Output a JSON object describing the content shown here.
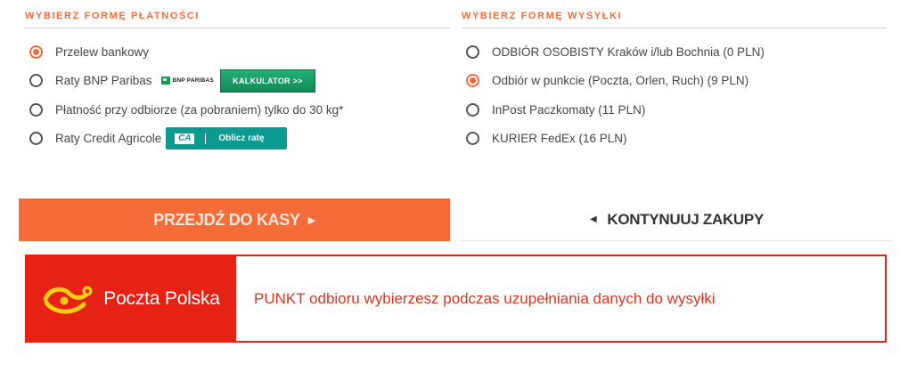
{
  "payment": {
    "title": "WYBIERZ FORMĘ PŁATNOŚCI",
    "options": [
      {
        "label": "Przelew bankowy",
        "checked": true
      },
      {
        "label": "Raty BNP Paribas",
        "checked": false,
        "logo_text": "BNP PARIBAS",
        "button": "KALKULATOR >>"
      },
      {
        "label": "Płatność przy odbiorze (za pobraniem) tylko do 30 kg*",
        "checked": false
      },
      {
        "label": "Raty Credit Agricole",
        "checked": false,
        "logo_text": "CA",
        "button": "Oblicz ratę"
      }
    ]
  },
  "shipping": {
    "title": "WYBIERZ FORMĘ WYSYŁKI",
    "options": [
      {
        "label": "ODBIÓR OSOBISTY Kraków i/lub Bochnia (0 PLN)",
        "checked": false
      },
      {
        "label": "Odbiór w punkcie (Poczta, Orlen, Ruch) (9 PLN)",
        "checked": true
      },
      {
        "label": "InPost Paczkomaty (11 PLN)",
        "checked": false
      },
      {
        "label": "KURIER FedEx (16 PLN)",
        "checked": false
      }
    ]
  },
  "actions": {
    "checkout_label": "PRZEJDŹ DO KASY",
    "checkout_icon": "triangle-right-icon",
    "continue_label": "KONTYNUUJ ZAKUPY",
    "continue_icon": "triangle-left-icon"
  },
  "notice": {
    "brand": "Poczta Polska",
    "message": "PUNKT odbioru wybierzesz podczas uzupełniania danych do wysyłki"
  },
  "colors": {
    "accent": "#f56c3a",
    "checkout_bg": "#f66c38",
    "pp_red": "#e52213",
    "pp_yellow": "#f7cf10",
    "bnp_green": "#1a9a56",
    "ca_teal": "#0b9a92"
  }
}
